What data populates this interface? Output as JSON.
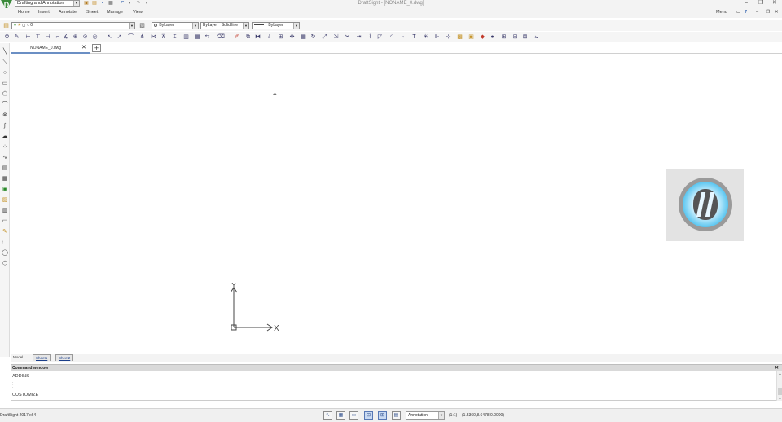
{
  "titlebar": {
    "workspace": "Drafting and Annotation",
    "window_title": "DraftSight - [NONAME_0.dwg]"
  },
  "menu": {
    "items": [
      "Home",
      "Insert",
      "Annotate",
      "Sheet",
      "Manage",
      "View"
    ],
    "right_label": "Menu"
  },
  "properties": {
    "layer_value": "0",
    "color_value": "ByLayer",
    "linestyle_byblock": "ByLayer",
    "linestyle_value": "Solid line",
    "lineweight_value": "ByLayer"
  },
  "document": {
    "tab_label": "NONAME_0.dwg",
    "close_glyph": "✕",
    "add_glyph": "+"
  },
  "canvas": {
    "ucs_x_label": "X",
    "ucs_y_label": "Y"
  },
  "layout_tabs": [
    "Model",
    "Sheet1",
    "Sheet2"
  ],
  "command_window": {
    "title": "Command window",
    "lines": [
      "ADDINS",
      "CUSTOMIZE"
    ]
  },
  "status": {
    "app_version": "DraftSight 2017 x64",
    "annotation_scale_label": "Annotation",
    "scale": "(1:1)",
    "coordinates": "(1.5360,8.6478,0.0000)"
  },
  "icons": {
    "left_toolbar": [
      "line-icon",
      "polyline-icon",
      "circle-icon",
      "rectangle-icon",
      "polygon-icon",
      "arc-icon",
      "ellipse-icon",
      "spline-icon",
      "revcloud-icon",
      "point-icon",
      "construction-line-icon",
      "table-icon",
      "hatch-icon",
      "block-icon",
      "insert-icon",
      "attribute-icon",
      "note-icon",
      "text-icon",
      "image-icon",
      "region-icon",
      "donut-icon",
      "wipeout-icon"
    ]
  },
  "colors": {
    "accent": "#6b8fc4",
    "logo_blue": "#5bc6f0",
    "toolbar_bg": "#f5f5f5"
  }
}
